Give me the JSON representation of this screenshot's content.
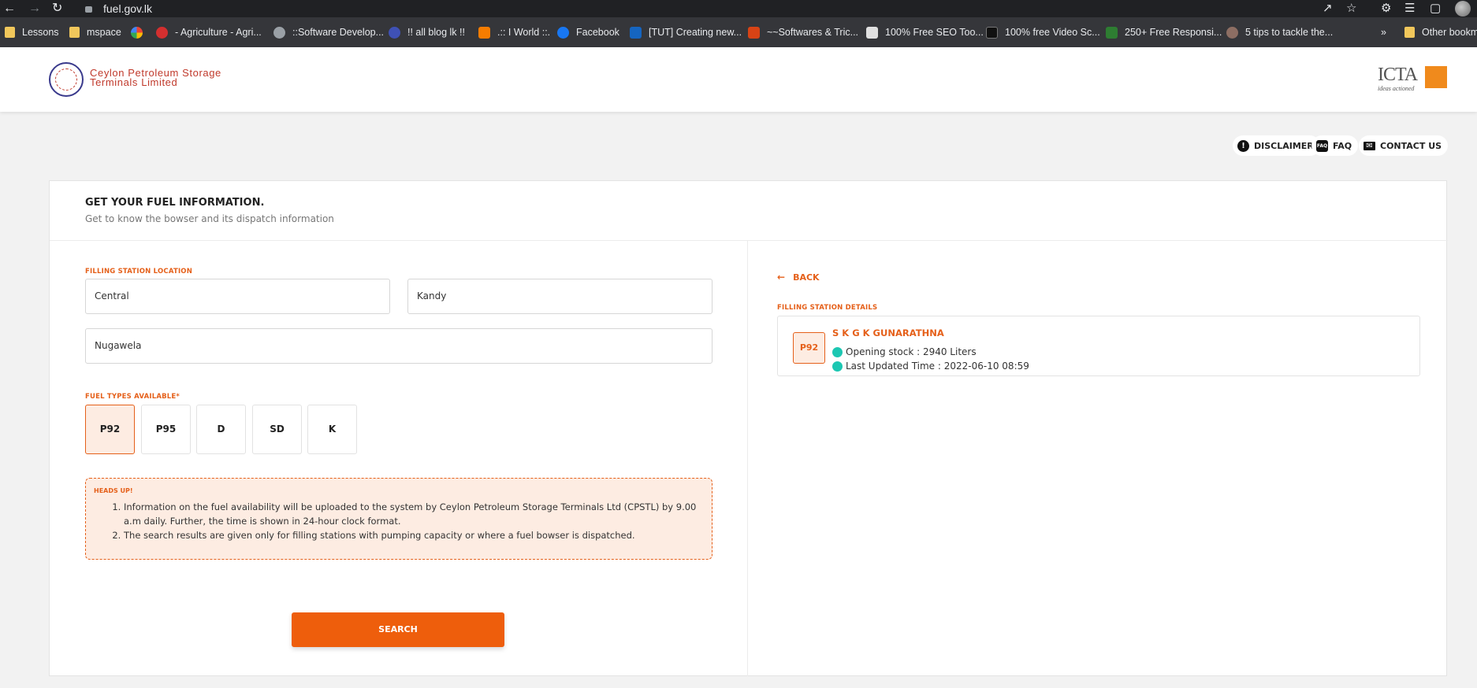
{
  "browser": {
    "url": "fuel.gov.lk",
    "bookmarks": [
      {
        "label": "Lessons",
        "icon": "folder-icon",
        "color": "#f1c75b"
      },
      {
        "label": "mspace",
        "icon": "folder-icon",
        "color": "#f1c75b"
      },
      {
        "label": "",
        "icon": "google-icon",
        "color": "#ffffff"
      },
      {
        "label": "- Agriculture - Agri...",
        "icon": "site-icon",
        "color": "#d32f2f"
      },
      {
        "label": "::Software Develop...",
        "icon": "globe-icon",
        "color": "#9aa0a6"
      },
      {
        "label": "!! all blog lk !!",
        "icon": "site-icon",
        "color": "#3f51b5"
      },
      {
        "label": ".:: I World ::.",
        "icon": "blogger-icon",
        "color": "#f57c00"
      },
      {
        "label": "Facebook",
        "icon": "facebook-icon",
        "color": "#1877f2"
      },
      {
        "label": "[TUT] Creating new...",
        "icon": "site-icon",
        "color": "#1565c0"
      },
      {
        "label": "~~Softwares & Tric...",
        "icon": "site-icon",
        "color": "#d84315"
      },
      {
        "label": "100% Free SEO Too...",
        "icon": "site-icon",
        "color": "#e0e0e0"
      },
      {
        "label": "100% free Video Sc...",
        "icon": "site-icon",
        "color": "#111111"
      },
      {
        "label": "250+ Free Responsi...",
        "icon": "chat-icon",
        "color": "#2e7d32"
      },
      {
        "label": "5 tips to tackle the...",
        "icon": "site-icon",
        "color": "#8d6e63"
      }
    ],
    "other_bookmarks": "Other bookm",
    "overflow": "»"
  },
  "header": {
    "org_line1": "Ceylon Petroleum Storage",
    "org_line2": "Terminals Limited",
    "partner_logo": "ICTA",
    "partner_tagline": "ideas actioned"
  },
  "top_links": {
    "disclaimer": "DISCLAIMER",
    "faq": "FAQ",
    "contact": "CONTACT US"
  },
  "form": {
    "title": "GET YOUR FUEL INFORMATION.",
    "subtitle": "Get to know the bowser and its dispatch information",
    "location_label": "FILLING STATION LOCATION",
    "province": "Central",
    "district": "Kandy",
    "city": "Nugawela",
    "fuel_types_label": "FUEL TYPES AVAILABLE*",
    "fuel_types": [
      "P92",
      "P95",
      "D",
      "SD",
      "K"
    ],
    "selected_fuel": "P92",
    "heads_up_title": "HEADS UP!",
    "heads_up_items": [
      "Information on the fuel availability will be uploaded to the system by Ceylon Petroleum Storage Terminals Ltd (CPSTL) by 9.00 a.m daily. Further, the time is shown in 24-hour clock format.",
      "The search results are given only for filling stations with pumping capacity or where a fuel bowser is dispatched."
    ],
    "search_label": "SEARCH"
  },
  "results": {
    "back_label": "BACK",
    "details_label": "FILLING STATION DETAILS",
    "fuel_badge": "P92",
    "station_name": "S K G K GUNARATHNA",
    "opening_stock": "Opening stock : 2940 Liters",
    "last_updated": "Last Updated Time : 2022-06-10 08:59"
  },
  "colors": {
    "accent": "#ee5e0c",
    "status_dot": "#1cc7b2"
  }
}
